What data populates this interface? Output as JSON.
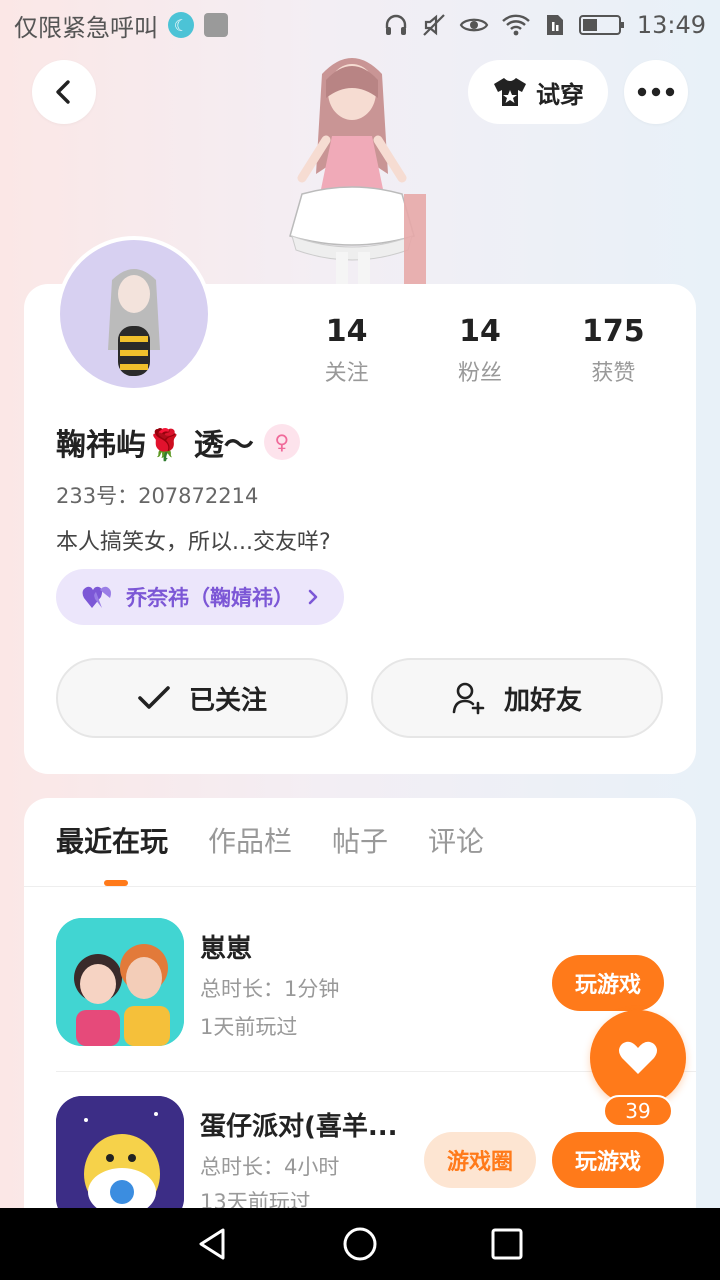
{
  "status_bar": {
    "carrier": "仅限紧急呼叫",
    "time": "13:49"
  },
  "header": {
    "back_icon": "chevron-left-icon",
    "try_on_label": "试穿",
    "more_icon": "more-dots-icon"
  },
  "profile": {
    "stats": [
      {
        "value": "14",
        "label": "关注"
      },
      {
        "value": "14",
        "label": "粉丝"
      },
      {
        "value": "175",
        "label": "获赞"
      }
    ],
    "name": "鞠祎屿🌹  透～",
    "uid": "233号：207872214",
    "bio": "本人搞笑女，所以...交友咩?",
    "relation": "乔奈祎（鞠婧祎）",
    "follow_label": "已关注",
    "add_friend_label": "加好友"
  },
  "tabs": [
    "最近在玩",
    "作品栏",
    "帖子",
    "评论"
  ],
  "games": [
    {
      "title": "崽崽",
      "duration": "总时长：1分钟",
      "last_played": "1天前玩过",
      "play_label": "玩游戏"
    },
    {
      "title": "蛋仔派对(喜羊...",
      "duration": "总时长：4小时",
      "last_played": "13天前玩过",
      "circle_label": "游戏圈",
      "play_label": "玩游戏"
    }
  ],
  "like_fab": {
    "count": "39"
  },
  "colors": {
    "accent": "#ff7a1a",
    "relation": "#7c57d6"
  }
}
